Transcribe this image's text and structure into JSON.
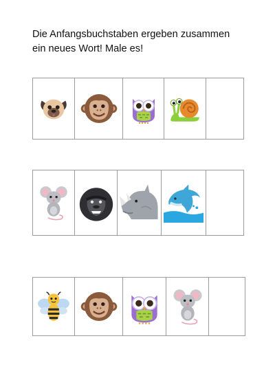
{
  "instruction": {
    "line1": "Die Anfangsbuchstaben ergeben zusammen",
    "line2": "ein neues Wort! Male es!"
  },
  "puzzles": [
    {
      "pictures": [
        "pug-icon",
        "monkey-icon",
        "owl-icon",
        "snail-icon"
      ],
      "answer": ""
    },
    {
      "pictures": [
        "mouse-icon",
        "gorilla-icon",
        "rhino-icon",
        "dolphin-icon"
      ],
      "answer": ""
    },
    {
      "pictures": [
        "bee-icon",
        "monkey-icon",
        "owl-icon",
        "mouse-icon"
      ],
      "answer": ""
    }
  ]
}
